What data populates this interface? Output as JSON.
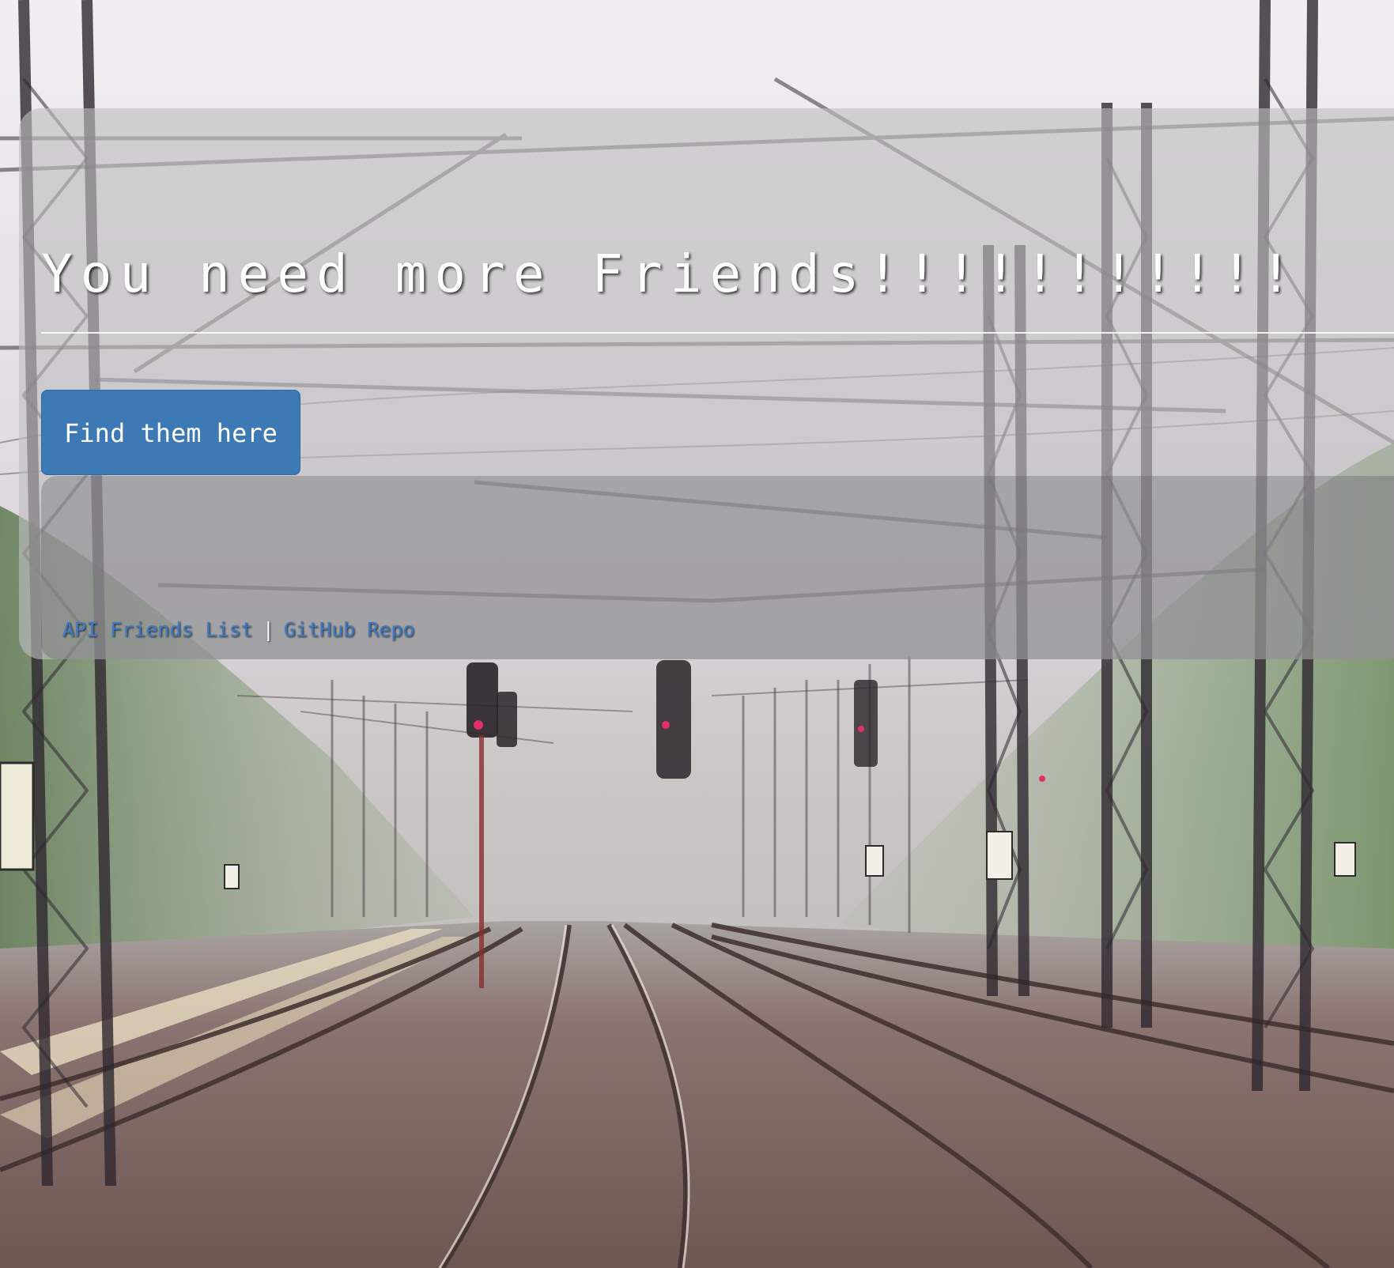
{
  "page": {
    "heading": "You need more Friends!!!!!!!!!!!",
    "cta_button_label": "Find them here"
  },
  "footer": {
    "link_api": "API Friends List",
    "separator": "|",
    "link_repo": "GitHub Repo"
  },
  "colors": {
    "button_bg": "#3d79b4",
    "link": "#3d79c4",
    "heading_text": "#ffffff"
  }
}
